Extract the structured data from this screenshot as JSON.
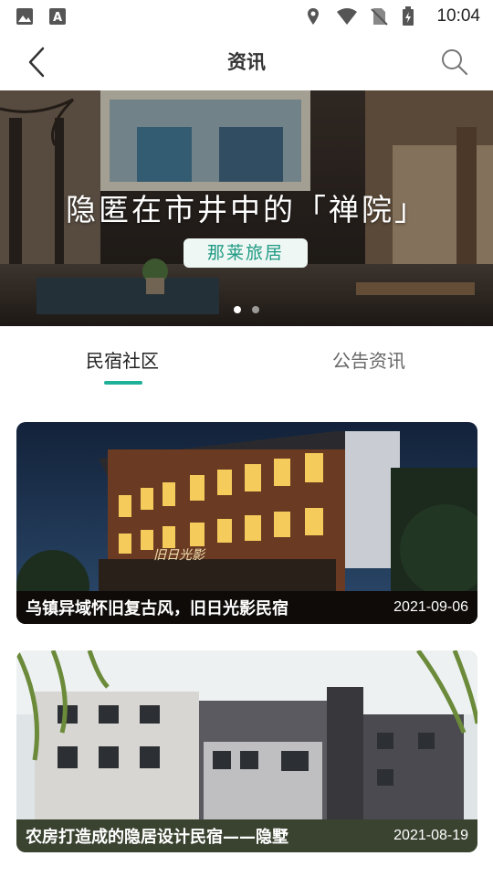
{
  "status_bar": {
    "time": "10:04",
    "icons": [
      "image-icon",
      "a-badge-icon",
      "location-icon",
      "wifi-icon",
      "no-sim-icon",
      "battery-icon"
    ]
  },
  "header": {
    "title": "资讯",
    "back_icon": "back-chevron-icon",
    "search_icon": "search-icon"
  },
  "banner": {
    "headline": "隐匿在市井中的「禅院」",
    "tag": "那莱旅居",
    "page_count": 2,
    "active_page": 1
  },
  "tabs": {
    "items": [
      {
        "label": "民宿社区",
        "active": true
      },
      {
        "label": "公告资讯",
        "active": false
      }
    ],
    "accent_color": "#1fb099"
  },
  "articles": [
    {
      "title": "乌镇异域怀旧复古风，旧日光影民宿",
      "date": "2021-09-06"
    },
    {
      "title": "农房打造成的隐居设计民宿——隐墅",
      "date": "2021-08-19"
    }
  ]
}
